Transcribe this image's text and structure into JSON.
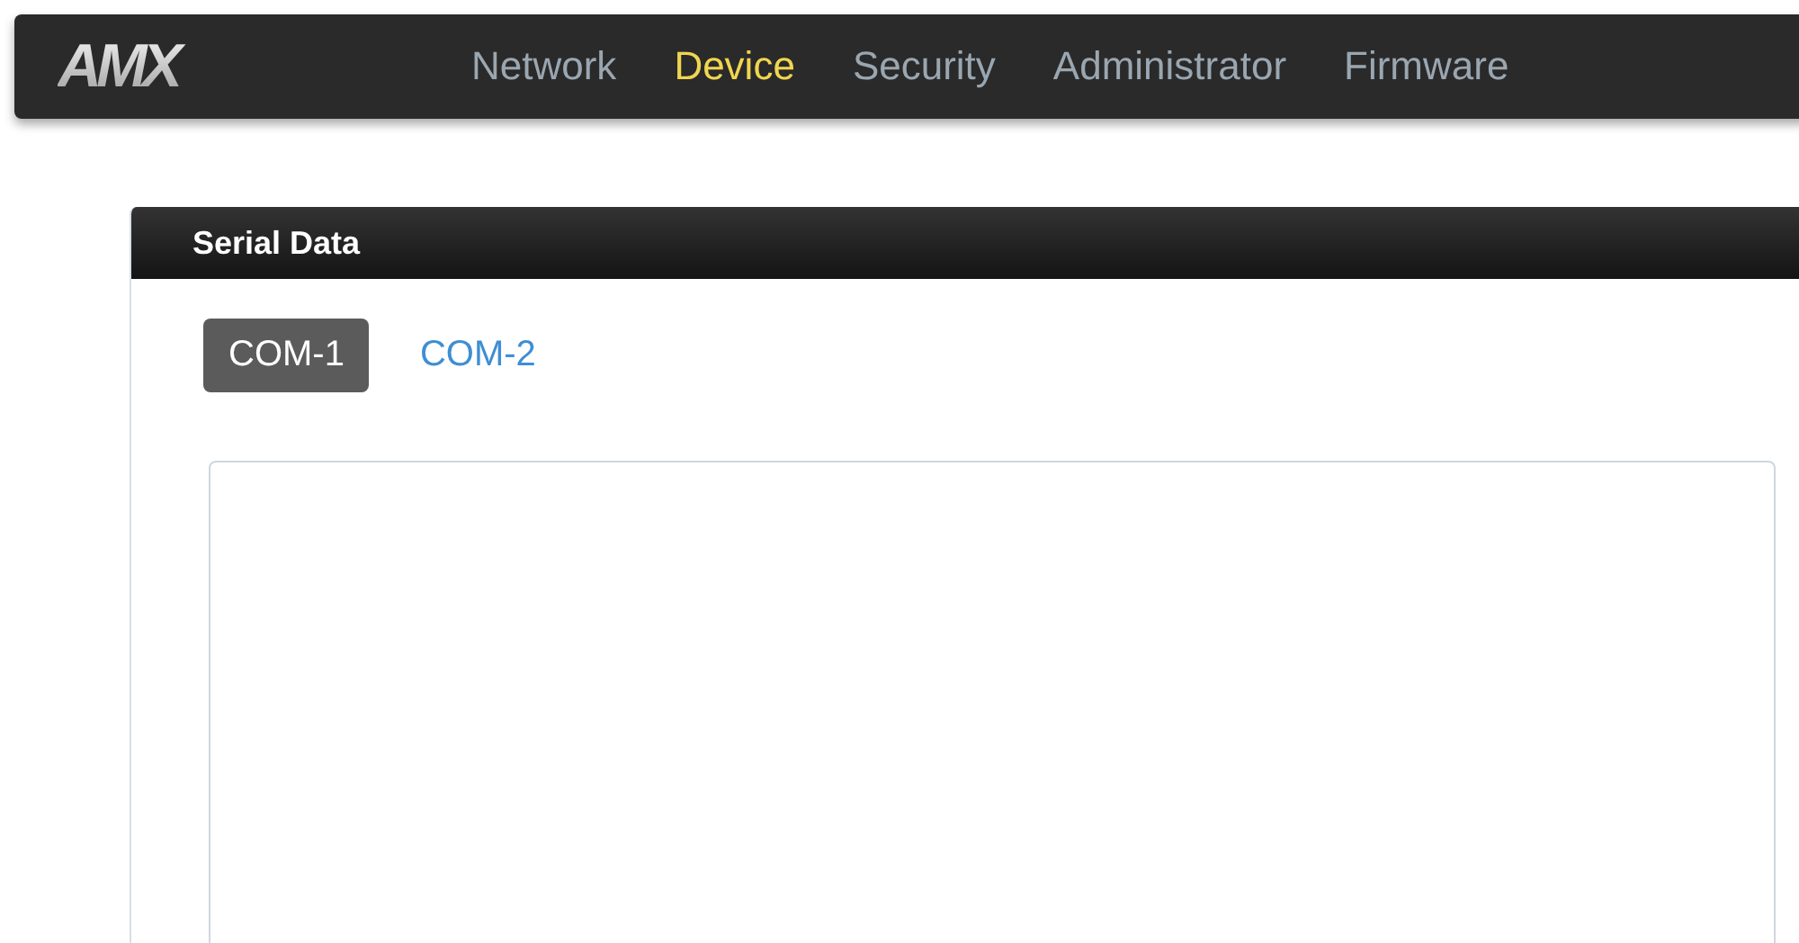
{
  "navbar": {
    "logo": "AMX",
    "items": [
      {
        "label": "Network",
        "selected": false
      },
      {
        "label": "Device",
        "selected": true
      },
      {
        "label": "Security",
        "selected": false
      },
      {
        "label": "Administrator",
        "selected": false
      },
      {
        "label": "Firmware",
        "selected": false
      }
    ]
  },
  "panel": {
    "title": "Serial Data",
    "tabs": [
      {
        "label": "COM-1",
        "selected": true
      },
      {
        "label": "COM-2",
        "selected": false
      }
    ]
  }
}
